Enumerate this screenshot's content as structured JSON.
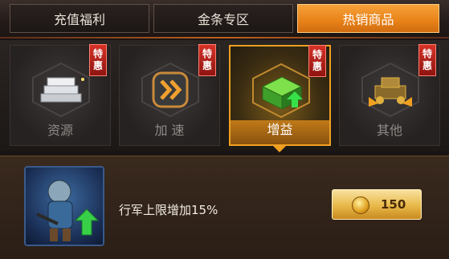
{
  "tabs": [
    {
      "label": "充值福利"
    },
    {
      "label": "金条专区"
    },
    {
      "label": "热销商品"
    }
  ],
  "active_tab": 2,
  "categories": [
    {
      "label": "资源",
      "badge": "特惠",
      "icon": "silver-bars-icon"
    },
    {
      "label": "加 速",
      "badge": "特惠",
      "icon": "speed-chevron-icon"
    },
    {
      "label": "增益",
      "badge": "特惠",
      "icon": "green-crate-icon"
    },
    {
      "label": "其他",
      "badge": "特惠",
      "icon": "gold-machine-icon"
    }
  ],
  "selected_category": 2,
  "item": {
    "description": "行军上限增加15%",
    "price": "150",
    "icon": "soldier-upgrade-icon"
  },
  "colors": {
    "active_tab": "#e88218",
    "badge": "#c02a20",
    "buy_button": "#e8b848"
  }
}
